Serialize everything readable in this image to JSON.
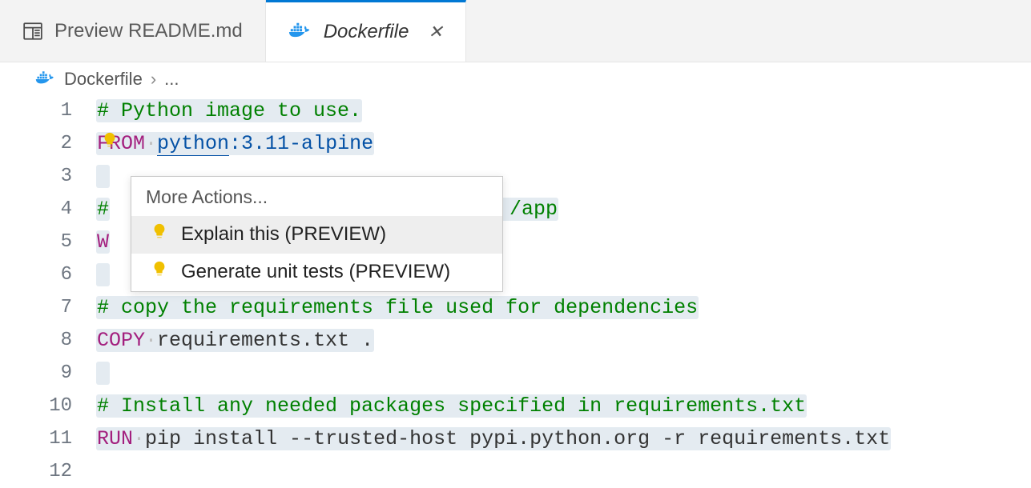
{
  "tabs": {
    "preview": {
      "label": "Preview README.md"
    },
    "dockerfile": {
      "label": "Dockerfile"
    }
  },
  "breadcrumb": {
    "file": "Dockerfile",
    "tail": "..."
  },
  "code": {
    "l1_comment": "# Python image to use.",
    "l2_from": "FROM",
    "l2_image": "python",
    "l2_tag": ":3.11-alpine",
    "l4_comment_prefix": "#",
    "l4_comment_suffix": "o /app",
    "l5_workdir": "W",
    "l7_comment": "# copy the requirements file used for dependencies",
    "l8_copy": "COPY",
    "l8_args": "requirements.txt .",
    "l10_comment": "# Install any needed packages specified in requirements.txt",
    "l11_run": "RUN",
    "l11_args": "pip install --trusted-host pypi.python.org -r requirements.txt"
  },
  "line_numbers": [
    "1",
    "2",
    "3",
    "4",
    "5",
    "6",
    "7",
    "8",
    "9",
    "10",
    "11",
    "12"
  ],
  "popup": {
    "title": "More Actions...",
    "item1": "Explain this (PREVIEW)",
    "item2": "Generate unit tests (PREVIEW)"
  }
}
